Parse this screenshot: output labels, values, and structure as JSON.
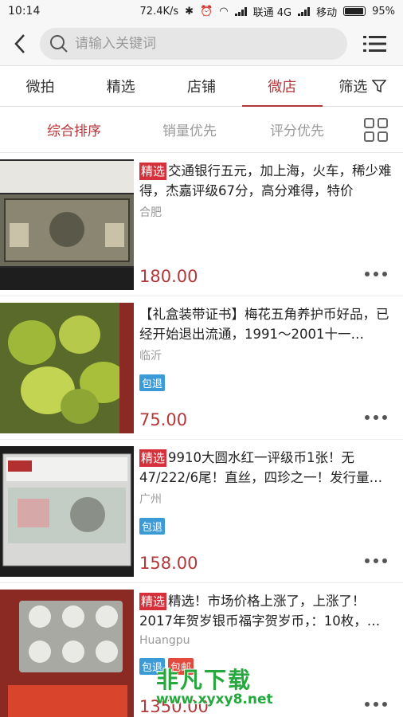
{
  "status": {
    "time": "10:14",
    "speed": "72.4K/s",
    "carrier1": "联通 4G",
    "carrier2": "移动",
    "battery": "95%",
    "battery_level": 0.95
  },
  "search": {
    "placeholder": "请输入关键词"
  },
  "tabs": [
    {
      "label": "微拍",
      "active": false
    },
    {
      "label": "精选",
      "active": false
    },
    {
      "label": "店铺",
      "active": false
    },
    {
      "label": "微店",
      "active": true
    },
    {
      "label": "筛选",
      "active": false
    }
  ],
  "sort": [
    {
      "label": "综合排序",
      "active": true
    },
    {
      "label": "销量优先",
      "active": false
    },
    {
      "label": "评分优先",
      "active": false
    }
  ],
  "items": [
    {
      "tag": "精选",
      "title": "交通银行五元，加上海，火车，稀少难得，杰嘉评级67分，高分难得，特价",
      "location": "合肥",
      "badges": [],
      "price": "180.00"
    },
    {
      "tag": "",
      "title": "【礼盒装带证书】梅花五角养护币好品，已经开始退出流通，1991～2001十一…",
      "location": "临沂",
      "badges": [
        "包退"
      ],
      "price": "75.00"
    },
    {
      "tag": "精选",
      "title": "9910大圆水红一评级币1张！无47/222/6尾！直丝，四珍之一！发行量…",
      "location": "广州",
      "badges": [
        "包退"
      ],
      "price": "158.00"
    },
    {
      "tag": "精选",
      "title": "精选！市场价格上涨了，上涨了！2017年贺岁银币福字贺岁币，：10枚，…",
      "location": "Huangpu",
      "badges": [
        "包退",
        "包邮"
      ],
      "price": "1350.00"
    }
  ],
  "watermark": {
    "text": "非凡下载",
    "url": "www.xyxy8.net"
  },
  "colors": {
    "accent": "#b4373a",
    "tag_red": "#d6303a",
    "badge_blue": "#3a9bd6"
  }
}
